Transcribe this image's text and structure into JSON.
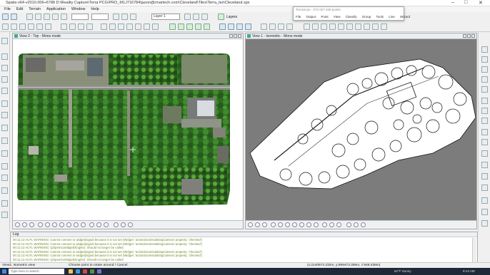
{
  "window": {
    "title": "Spatix-v64-v2010.006+6788  D:\\Reality Capture\\Terra PCG\\PRO_M1J716784\\jason@rmartech.com\\Cleveland\\Tiles\\Terra_tex\\Cleveland.spx",
    "min_glyph": "–",
    "max_glyph": "□",
    "close_glyph": "✕"
  },
  "menu": [
    "File",
    "Edit",
    "Terrain",
    "Application",
    "Window",
    "Help"
  ],
  "toolbar": {
    "layer_combo": "Layer 1",
    "layers_label": "Layers"
  },
  "tooltip_window": {
    "title": "TerraScan - 272 027 340 points",
    "menu": [
      "File",
      "Output",
      "Point",
      "View",
      "Classify",
      "Group",
      "Tools",
      "Line",
      "Wizard"
    ]
  },
  "views": {
    "left": {
      "title": "View 2 - Top - Mono mode"
    },
    "right": {
      "title": "View 1 - Isometric - Mono mode"
    }
  },
  "log": {
    "title": "Log",
    "lines": [
      "00:11:13 AUTL WARNING: Cannot connect to widget(signal because it is not set (Widget: 'actionZoomIsolatingCamera' property: 'checked')",
      "00:11:13 AUTL WARNING: Cannot connect to widget(signal because it is not set (Widget: 'actionZoomIsolatingCamera' property: 'checked')",
      "00:11:13 AUTL WARNING: QOpenGLWidget(Engine): Should no longer be called",
      "00:11:13 AUTL WARNING: Cannot connect to widget(signal because it is not set (Widget: 'actionZoomIsolatingCamera' property: 'checked')",
      "00:11:13 AUTL WARNING: Cannot connect to widget(signal because it is not set (Widget: 'actionZoomIsolatingCamera' property: 'checked')",
      "00:11:13 AUTL WARNING: QOpenGLWidget(Engine): Should no longer be called"
    ]
  },
  "status": {
    "left": "View1: Isometric view",
    "middle": "Choose point to rotate around / Cancel",
    "coords": "(x:2140672.232m, y:599473.306m, z:948.038m)"
  },
  "taskbar": {
    "search_placeholder": "Type here to search",
    "weather": "62°F  Sunny",
    "time": "9:14 AM"
  },
  "colors": {
    "viewport_bg": "#7c7c7c",
    "log_text": "#6f8a2a",
    "taskbar": "#1f2a38"
  }
}
